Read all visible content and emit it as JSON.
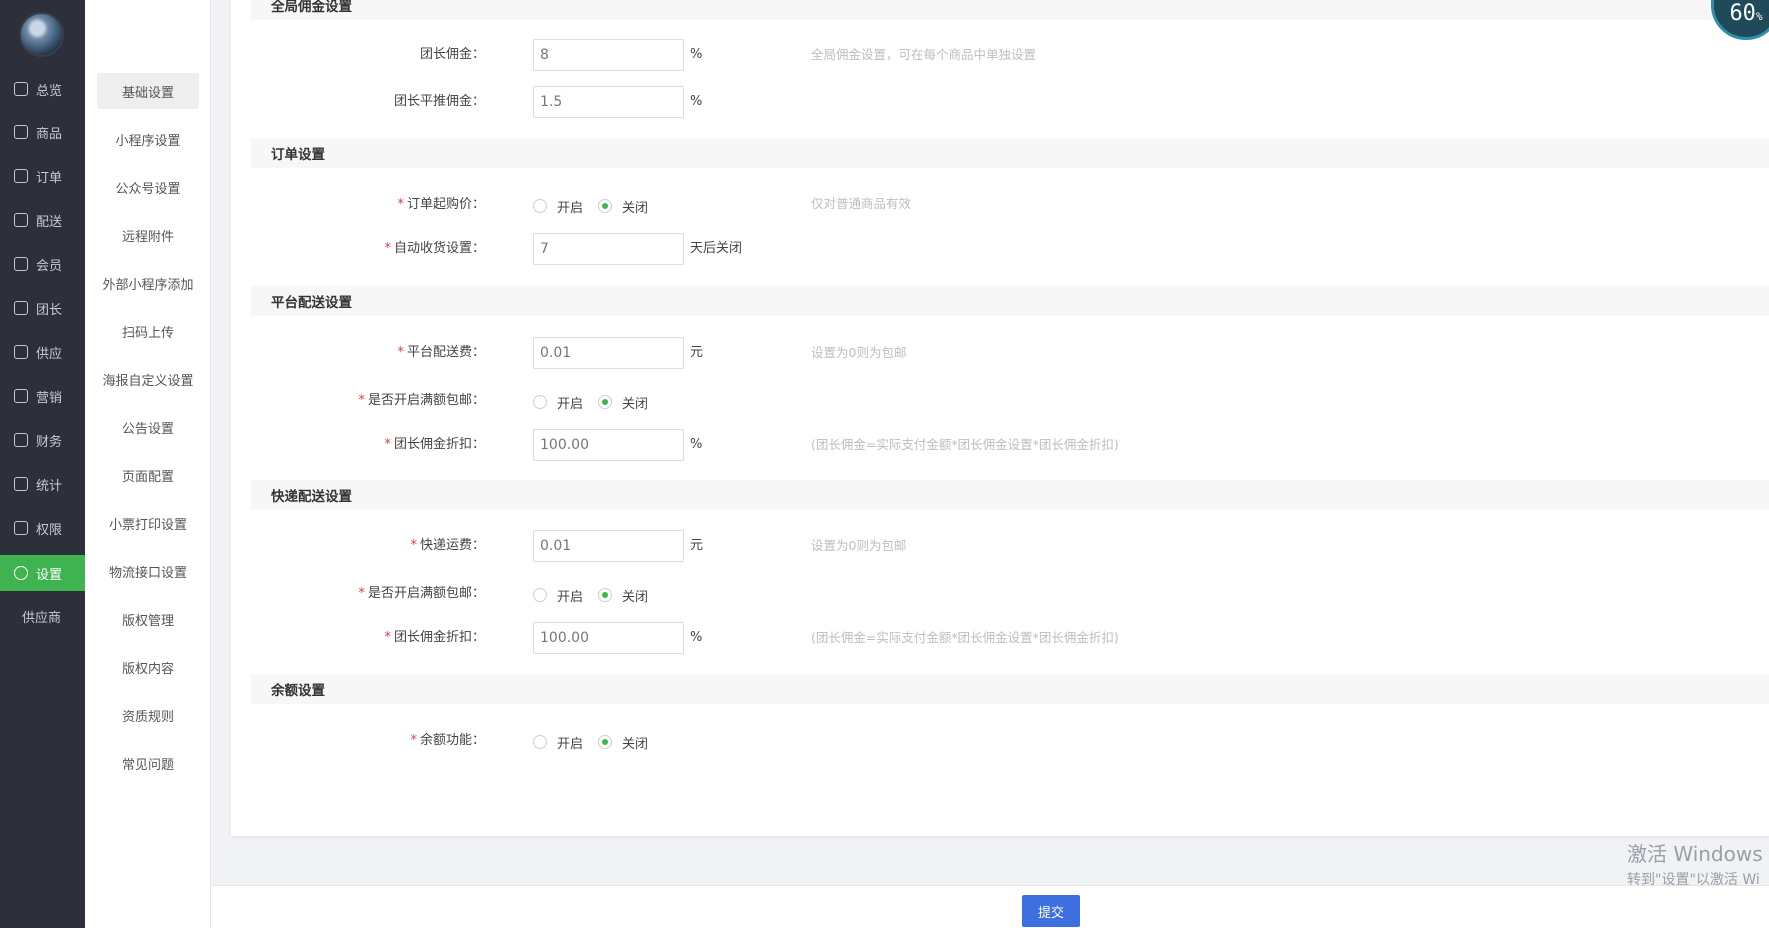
{
  "nav": {
    "items": [
      {
        "label": "总览",
        "icon": "home-icon"
      },
      {
        "label": "商品",
        "icon": "goods-icon"
      },
      {
        "label": "订单",
        "icon": "order-icon"
      },
      {
        "label": "配送",
        "icon": "delivery-icon"
      },
      {
        "label": "会员",
        "icon": "member-icon"
      },
      {
        "label": "团长",
        "icon": "leader-icon"
      },
      {
        "label": "供应",
        "icon": "supply-icon"
      },
      {
        "label": "营销",
        "icon": "gift-icon"
      },
      {
        "label": "财务",
        "icon": "finance-icon"
      },
      {
        "label": "统计",
        "icon": "chart-icon"
      },
      {
        "label": "权限",
        "icon": "shield-icon"
      },
      {
        "label": "设置",
        "icon": "gear-icon"
      },
      {
        "label": "供应商",
        "icon": ""
      }
    ],
    "active": "设置"
  },
  "subnav": {
    "items": [
      "基础设置",
      "小程序设置",
      "公众号设置",
      "远程附件",
      "外部小程序添加",
      "扫码上传",
      "海报自定义设置",
      "公告设置",
      "页面配置",
      "小票打印设置",
      "物流接口设置",
      "版权管理",
      "版权内容",
      "资质规则",
      "常见问题"
    ],
    "active": "基础设置"
  },
  "sections": {
    "commission": {
      "title": "全局佣金设置",
      "leader_label": "团长佣金：",
      "leader_value": "8",
      "leader_unit": "%",
      "leader_hint": "全局佣金设置，可在每个商品中单独设置",
      "push_label": "团长平推佣金：",
      "push_value": "1.5",
      "push_unit": "%"
    },
    "order": {
      "title": "订单设置",
      "min_label": "订单起购价：",
      "min_hint": "仅对普通商品有效",
      "auto_label": "自动收货设置：",
      "auto_value": "7",
      "auto_unit": "天后关闭"
    },
    "platform": {
      "title": "平台配送设置",
      "fee_label": "平台配送费：",
      "fee_value": "0.01",
      "fee_unit": "元",
      "fee_hint": "设置为0则为包邮",
      "free_label": "是否开启满额包邮：",
      "discount_label": "团长佣金折扣：",
      "discount_value": "100.00",
      "discount_unit": "%",
      "discount_hint": "(团长佣金=实际支付金额*团长佣金设置*团长佣金折扣)"
    },
    "express": {
      "title": "快递配送设置",
      "fee_label": "快递运费：",
      "fee_value": "0.01",
      "fee_unit": "元",
      "fee_hint": "设置为0则为包邮",
      "free_label": "是否开启满额包邮：",
      "discount_label": "团长佣金折扣：",
      "discount_value": "100.00",
      "discount_unit": "%",
      "discount_hint": "(团长佣金=实际支付金额*团长佣金设置*团长佣金折扣)"
    },
    "balance": {
      "title": "余额设置",
      "func_label": "余额功能："
    }
  },
  "radio": {
    "on": "开启",
    "off": "关闭",
    "selected": "关闭"
  },
  "required_mark": "*",
  "submit_label": "提交",
  "gauge": {
    "value": "60",
    "unit": "%"
  },
  "watermark": {
    "line1": "激活 Windows",
    "line2": "转到\"设置\"以激活 Wi"
  },
  "colors": {
    "sidebar": "#2d2f3b",
    "active": "#3fb34f",
    "submit": "#3d6fe0"
  }
}
